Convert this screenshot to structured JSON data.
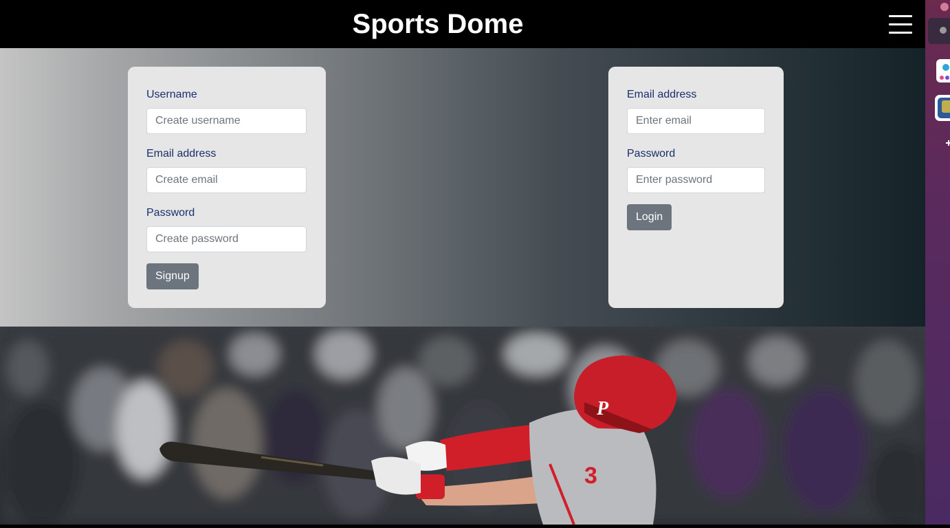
{
  "navbar": {
    "brand": "Sports Dome",
    "menu_icon": "hamburger-menu-icon"
  },
  "signup": {
    "username_label": "Username",
    "username_placeholder": "Create username",
    "email_label": "Email address",
    "email_placeholder": "Create email",
    "password_label": "Password",
    "password_placeholder": "Create password",
    "button_label": "Signup"
  },
  "login": {
    "email_label": "Email address",
    "email_placeholder": "Enter email",
    "password_label": "Password",
    "password_placeholder": "Enter password",
    "button_label": "Login"
  },
  "colors": {
    "navbar_bg": "#000000",
    "card_bg": "#e6e6e6",
    "label_color": "#1a2f6b",
    "button_bg": "#6c757d",
    "player_red": "#d11f2a",
    "uniform_gray": "#b9bbbe"
  }
}
